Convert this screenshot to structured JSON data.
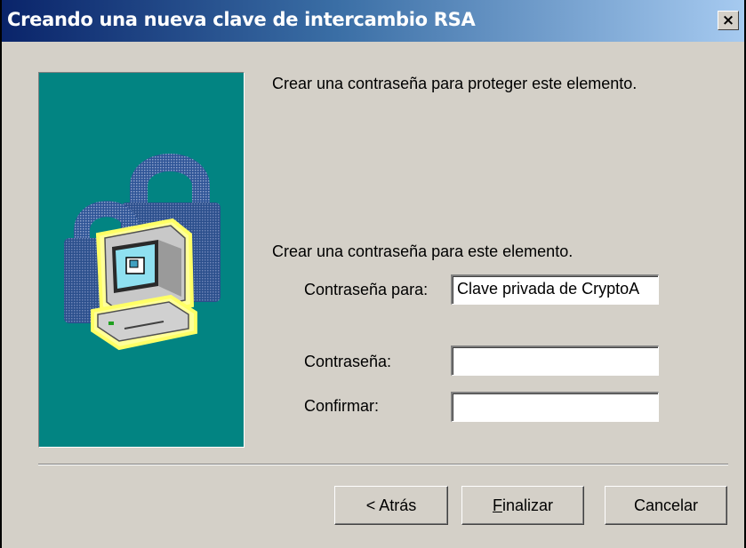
{
  "window": {
    "title": "Creando una nueva clave de intercambio RSA",
    "close_label": "×"
  },
  "content": {
    "intro": "Crear una contraseña para proteger este elemento.",
    "section_label": "Crear una contraseña para este elemento.",
    "password_for_label": "Contraseña para:",
    "password_for_value": "Clave privada de CryptoA",
    "password_label": "Contraseña:",
    "password_value": "",
    "confirm_label": "Confirmar:",
    "confirm_value": ""
  },
  "buttons": {
    "back_label": "< Atrás",
    "finish_mnemonic": "F",
    "finish_rest": "inalizar",
    "cancel_label": "Cancelar"
  },
  "icons": {
    "side_illustration": "computer-with-padlock-icon"
  },
  "colors": {
    "panel_teal": "#028482",
    "titlebar_start": "#0a246a",
    "titlebar_end": "#a6caf0",
    "dialog_face": "#d4d0c8"
  }
}
